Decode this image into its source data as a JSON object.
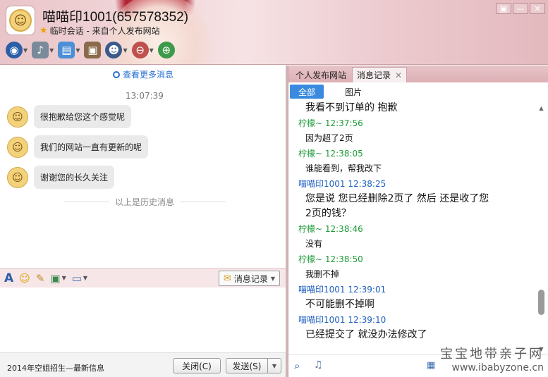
{
  "window": {
    "title": "喵喵印1001(657578352)",
    "subtitle": "临时会话 - 来自个人发布网站",
    "controls": [
      "▣",
      "—",
      "✕"
    ]
  },
  "chat": {
    "more_messages": "查看更多消息",
    "time": "13:07:39",
    "messages": [
      "很抱歉给您这个感觉呢",
      "我们的网站一直有更新的呢",
      "谢谢您的长久关注"
    ],
    "history_divider": "以上是历史消息",
    "history_button": "消息记录",
    "ad_text": "2014年空姐招生—最新信息",
    "close_button": "关闭(C)",
    "send_button": "发送(S)"
  },
  "right_panel": {
    "tabs": [
      "个人发布网站",
      "消息记录"
    ],
    "filters": [
      "全部",
      "图片"
    ],
    "records": [
      {
        "type": "text",
        "text": "我看不到订单的 抱歉",
        "size": "big"
      },
      {
        "type": "sender",
        "text": "柠檬~ 12:37:56",
        "color": "green"
      },
      {
        "type": "text",
        "text": "因为超了2页",
        "size": "small"
      },
      {
        "type": "sender",
        "text": "柠檬~ 12:38:05",
        "color": "green"
      },
      {
        "type": "text",
        "text": "谁能看到，帮我改下",
        "size": "small"
      },
      {
        "type": "sender",
        "text": "喵喵印1001 12:38:25",
        "color": "blue"
      },
      {
        "type": "text",
        "text": "您是说 您已经删除2页了 然后 还是收了您",
        "size": "big"
      },
      {
        "type": "text",
        "text": "2页的钱？",
        "size": "big"
      },
      {
        "type": "sender",
        "text": "柠檬~ 12:38:46",
        "color": "green"
      },
      {
        "type": "text",
        "text": "没有",
        "size": "small"
      },
      {
        "type": "sender",
        "text": "柠檬~ 12:38:50",
        "color": "green"
      },
      {
        "type": "text",
        "text": "我删不掉",
        "size": "small"
      },
      {
        "type": "sender",
        "text": "喵喵印1001 12:39:01",
        "color": "blue"
      },
      {
        "type": "text",
        "text": "不可能删不掉啊",
        "size": "big"
      },
      {
        "type": "sender",
        "text": "喵喵印1001 12:39:10",
        "color": "blue"
      },
      {
        "type": "text",
        "text": "已经提交了 就没办法修改了",
        "size": "big"
      }
    ]
  },
  "watermark": {
    "line1": "宝宝地带亲子网",
    "line2": "www.ibabyzone.cn"
  }
}
